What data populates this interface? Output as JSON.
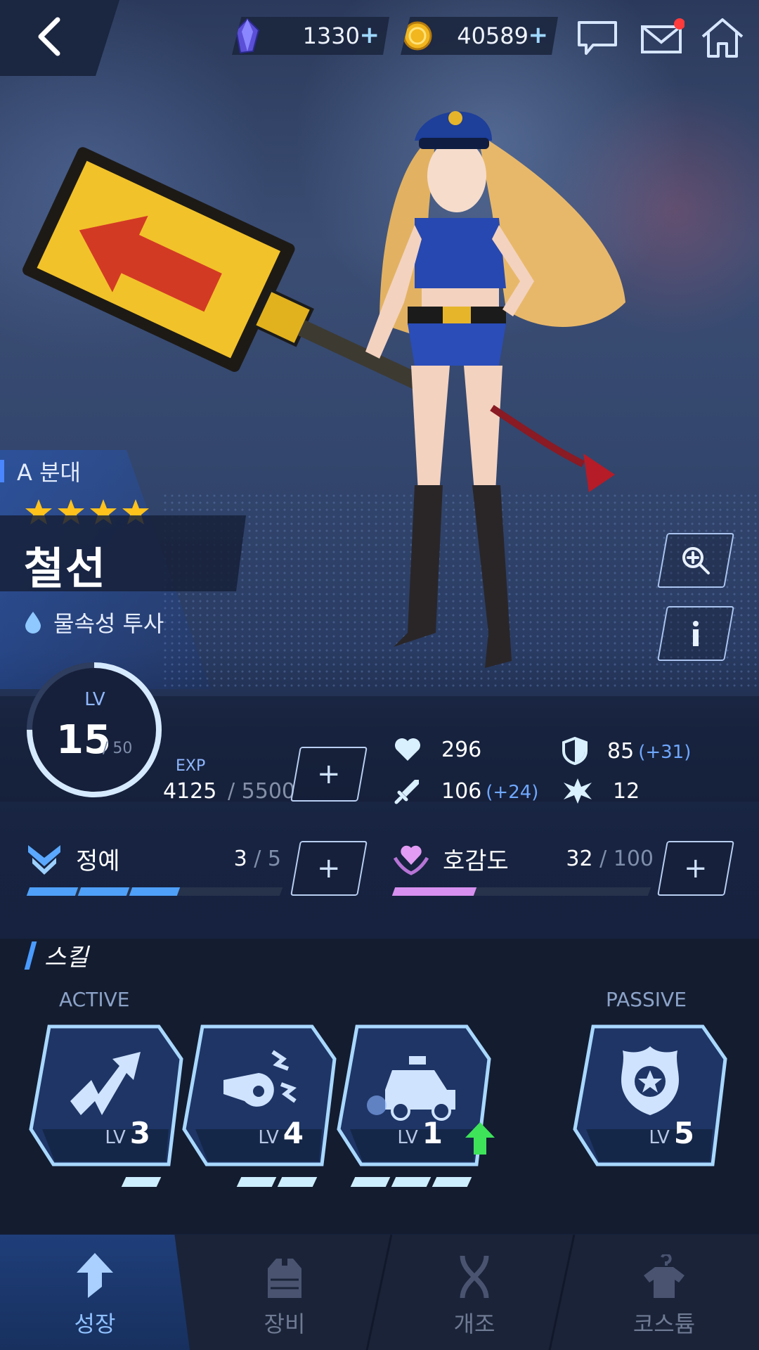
{
  "currency": {
    "gems": "1330",
    "gold": "40589",
    "plus": "+"
  },
  "top_icons": [
    "chat-icon",
    "mail-icon",
    "home-icon"
  ],
  "character": {
    "squad": "A 분대",
    "stars": 4,
    "name": "철선",
    "element": "물속성 투사"
  },
  "level": {
    "label": "LV",
    "value": "15",
    "max": "/ 50",
    "progress": 0.75,
    "exp_label": "EXP",
    "exp_current": "4125",
    "exp_max": "/ 5500"
  },
  "stats": {
    "hp": "296",
    "defense": "85",
    "defense_bonus": "(+31)",
    "attack": "106",
    "attack_bonus": "(+24)",
    "crit": "12"
  },
  "elite": {
    "label": "정예",
    "current": "3",
    "max": "/ 5",
    "segments_total": 5,
    "segments_filled": 3
  },
  "affinity": {
    "label": "호감도",
    "current": "32",
    "max": "/ 100",
    "fraction": 0.32
  },
  "skills": {
    "title": "스킬",
    "active_label": "ACTIVE",
    "passive_label": "PASSIVE",
    "lv_text": "LV",
    "items": [
      {
        "icon": "lightning-arrow-icon",
        "level": "3",
        "pips": 1
      },
      {
        "icon": "whistle-icon",
        "level": "4",
        "pips": 2
      },
      {
        "icon": "police-car-icon",
        "level": "1",
        "pips": 3,
        "upgrade": true
      },
      {
        "icon": "police-badge-icon",
        "level": "5"
      }
    ]
  },
  "nav": {
    "items": [
      "성장",
      "장비",
      "개조",
      "코스튬"
    ],
    "active": 0
  },
  "colors": {
    "accent": "#4a86ff",
    "gauge_blue": "#4fa0f8",
    "gauge_pink": "#d790ef",
    "bonus": "#6fa8ff",
    "upgrade_green": "#3ee35a"
  }
}
